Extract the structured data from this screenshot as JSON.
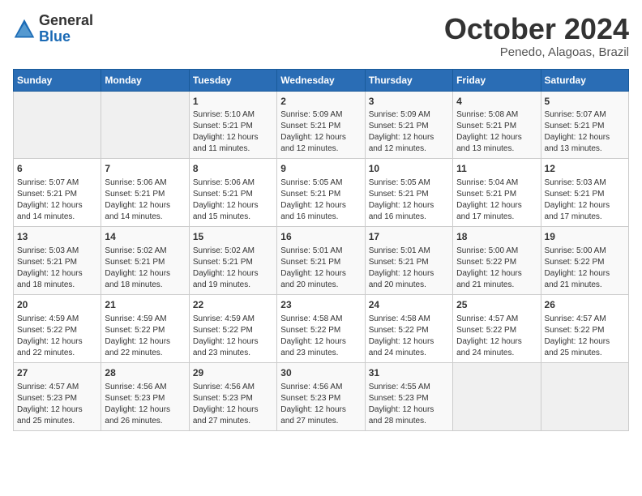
{
  "header": {
    "logo_general": "General",
    "logo_blue": "Blue",
    "month": "October 2024",
    "location": "Penedo, Alagoas, Brazil"
  },
  "days_of_week": [
    "Sunday",
    "Monday",
    "Tuesday",
    "Wednesday",
    "Thursday",
    "Friday",
    "Saturday"
  ],
  "weeks": [
    [
      {
        "day": "",
        "info": ""
      },
      {
        "day": "",
        "info": ""
      },
      {
        "day": "1",
        "info": "Sunrise: 5:10 AM\nSunset: 5:21 PM\nDaylight: 12 hours and 11 minutes."
      },
      {
        "day": "2",
        "info": "Sunrise: 5:09 AM\nSunset: 5:21 PM\nDaylight: 12 hours and 12 minutes."
      },
      {
        "day": "3",
        "info": "Sunrise: 5:09 AM\nSunset: 5:21 PM\nDaylight: 12 hours and 12 minutes."
      },
      {
        "day": "4",
        "info": "Sunrise: 5:08 AM\nSunset: 5:21 PM\nDaylight: 12 hours and 13 minutes."
      },
      {
        "day": "5",
        "info": "Sunrise: 5:07 AM\nSunset: 5:21 PM\nDaylight: 12 hours and 13 minutes."
      }
    ],
    [
      {
        "day": "6",
        "info": "Sunrise: 5:07 AM\nSunset: 5:21 PM\nDaylight: 12 hours and 14 minutes."
      },
      {
        "day": "7",
        "info": "Sunrise: 5:06 AM\nSunset: 5:21 PM\nDaylight: 12 hours and 14 minutes."
      },
      {
        "day": "8",
        "info": "Sunrise: 5:06 AM\nSunset: 5:21 PM\nDaylight: 12 hours and 15 minutes."
      },
      {
        "day": "9",
        "info": "Sunrise: 5:05 AM\nSunset: 5:21 PM\nDaylight: 12 hours and 16 minutes."
      },
      {
        "day": "10",
        "info": "Sunrise: 5:05 AM\nSunset: 5:21 PM\nDaylight: 12 hours and 16 minutes."
      },
      {
        "day": "11",
        "info": "Sunrise: 5:04 AM\nSunset: 5:21 PM\nDaylight: 12 hours and 17 minutes."
      },
      {
        "day": "12",
        "info": "Sunrise: 5:03 AM\nSunset: 5:21 PM\nDaylight: 12 hours and 17 minutes."
      }
    ],
    [
      {
        "day": "13",
        "info": "Sunrise: 5:03 AM\nSunset: 5:21 PM\nDaylight: 12 hours and 18 minutes."
      },
      {
        "day": "14",
        "info": "Sunrise: 5:02 AM\nSunset: 5:21 PM\nDaylight: 12 hours and 18 minutes."
      },
      {
        "day": "15",
        "info": "Sunrise: 5:02 AM\nSunset: 5:21 PM\nDaylight: 12 hours and 19 minutes."
      },
      {
        "day": "16",
        "info": "Sunrise: 5:01 AM\nSunset: 5:21 PM\nDaylight: 12 hours and 20 minutes."
      },
      {
        "day": "17",
        "info": "Sunrise: 5:01 AM\nSunset: 5:21 PM\nDaylight: 12 hours and 20 minutes."
      },
      {
        "day": "18",
        "info": "Sunrise: 5:00 AM\nSunset: 5:22 PM\nDaylight: 12 hours and 21 minutes."
      },
      {
        "day": "19",
        "info": "Sunrise: 5:00 AM\nSunset: 5:22 PM\nDaylight: 12 hours and 21 minutes."
      }
    ],
    [
      {
        "day": "20",
        "info": "Sunrise: 4:59 AM\nSunset: 5:22 PM\nDaylight: 12 hours and 22 minutes."
      },
      {
        "day": "21",
        "info": "Sunrise: 4:59 AM\nSunset: 5:22 PM\nDaylight: 12 hours and 22 minutes."
      },
      {
        "day": "22",
        "info": "Sunrise: 4:59 AM\nSunset: 5:22 PM\nDaylight: 12 hours and 23 minutes."
      },
      {
        "day": "23",
        "info": "Sunrise: 4:58 AM\nSunset: 5:22 PM\nDaylight: 12 hours and 23 minutes."
      },
      {
        "day": "24",
        "info": "Sunrise: 4:58 AM\nSunset: 5:22 PM\nDaylight: 12 hours and 24 minutes."
      },
      {
        "day": "25",
        "info": "Sunrise: 4:57 AM\nSunset: 5:22 PM\nDaylight: 12 hours and 24 minutes."
      },
      {
        "day": "26",
        "info": "Sunrise: 4:57 AM\nSunset: 5:22 PM\nDaylight: 12 hours and 25 minutes."
      }
    ],
    [
      {
        "day": "27",
        "info": "Sunrise: 4:57 AM\nSunset: 5:23 PM\nDaylight: 12 hours and 25 minutes."
      },
      {
        "day": "28",
        "info": "Sunrise: 4:56 AM\nSunset: 5:23 PM\nDaylight: 12 hours and 26 minutes."
      },
      {
        "day": "29",
        "info": "Sunrise: 4:56 AM\nSunset: 5:23 PM\nDaylight: 12 hours and 27 minutes."
      },
      {
        "day": "30",
        "info": "Sunrise: 4:56 AM\nSunset: 5:23 PM\nDaylight: 12 hours and 27 minutes."
      },
      {
        "day": "31",
        "info": "Sunrise: 4:55 AM\nSunset: 5:23 PM\nDaylight: 12 hours and 28 minutes."
      },
      {
        "day": "",
        "info": ""
      },
      {
        "day": "",
        "info": ""
      }
    ]
  ]
}
